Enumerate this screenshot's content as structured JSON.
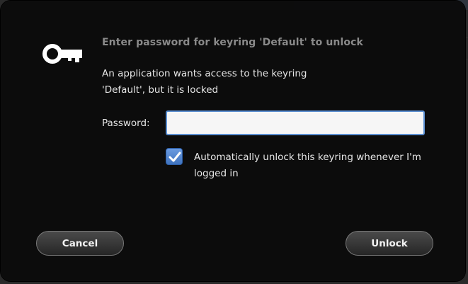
{
  "dialog": {
    "title": "Enter password for keyring 'Default' to unlock",
    "message": "An application wants access to the keyring 'Default', but it is locked",
    "icon": "key-icon"
  },
  "password": {
    "label": "Password:",
    "value": ""
  },
  "auto_unlock": {
    "checked": true,
    "label": "Automatically unlock this keyring whenever I'm logged in"
  },
  "buttons": {
    "cancel": "Cancel",
    "unlock": "Unlock"
  },
  "colors": {
    "accent": "#5b8fd1",
    "dialog_bg": "#0a0a0a",
    "text": "#e6e6e6",
    "title_text": "#8a8a8a"
  }
}
